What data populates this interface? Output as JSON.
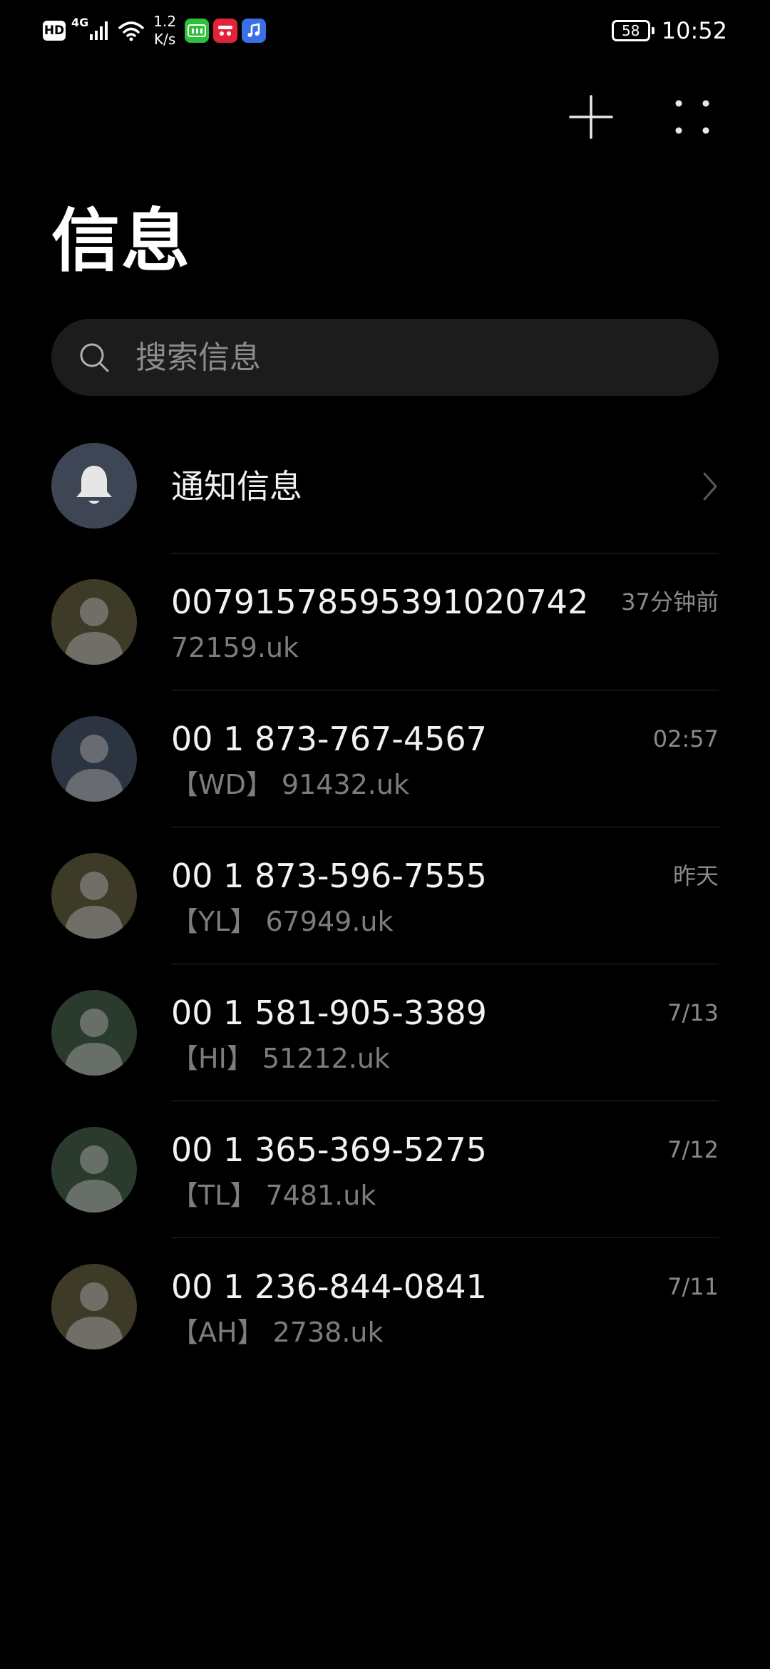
{
  "status_bar": {
    "hd": "HD",
    "network_type": "4G",
    "speed_value": "1.2",
    "speed_unit": "K/s",
    "battery": "58",
    "time": "10:52",
    "app_icons": [
      "iqiyi-icon",
      "tmall-icon",
      "music-icon"
    ]
  },
  "header": {
    "title": "信息",
    "add_icon": "plus-icon",
    "more_icon": "more-dots-icon"
  },
  "search": {
    "placeholder": "搜索信息"
  },
  "notification_row": {
    "label": "通知信息",
    "icon": "bell-icon"
  },
  "conversations": [
    {
      "sender": "00791578595391020742",
      "preview": "72159.uk",
      "time": "37分钟前",
      "avatar_color": "#3d3a28"
    },
    {
      "sender": "00 1 873-767-4567",
      "preview": "【WD】 91432.uk",
      "time": "02:57",
      "avatar_color": "#2b3440"
    },
    {
      "sender": "00 1 873-596-7555",
      "preview": "【YL】 67949.uk",
      "time": "昨天",
      "avatar_color": "#3d3a28"
    },
    {
      "sender": "00 1 581-905-3389",
      "preview": "【HI】 51212.uk",
      "time": "7/13",
      "avatar_color": "#2a3a2c"
    },
    {
      "sender": "00 1 365-369-5275",
      "preview": "【TL】 7481.uk",
      "time": "7/12",
      "avatar_color": "#2a3a2c"
    },
    {
      "sender": "00 1 236-844-0841",
      "preview": "【AH】 2738.uk",
      "time": "7/11",
      "avatar_color": "#3d3a28"
    }
  ]
}
